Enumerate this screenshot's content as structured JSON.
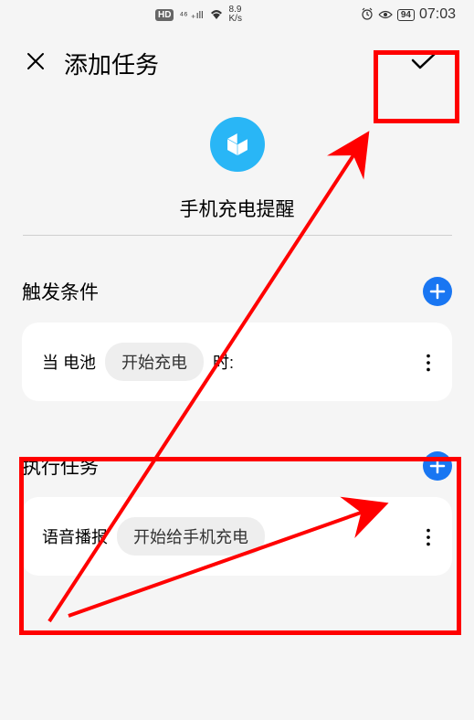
{
  "status": {
    "hd": "HD",
    "signal": "⁴⁶ ₊ıll",
    "wifi": "⥣",
    "speed_top": "8.9",
    "speed_bottom": "K/s",
    "alarm": "⏰",
    "eye": "👁",
    "battery": "94",
    "time": "07:03"
  },
  "header": {
    "close": "✕",
    "title": "添加任务",
    "confirm": "✓"
  },
  "task": {
    "name": "手机充电提醒"
  },
  "trigger": {
    "title": "触发条件",
    "prefix": "当 电池",
    "value": "开始充电",
    "suffix": "时:"
  },
  "action": {
    "title": "执行任务",
    "prefix": "语音播报",
    "value": "开始给手机充电"
  }
}
